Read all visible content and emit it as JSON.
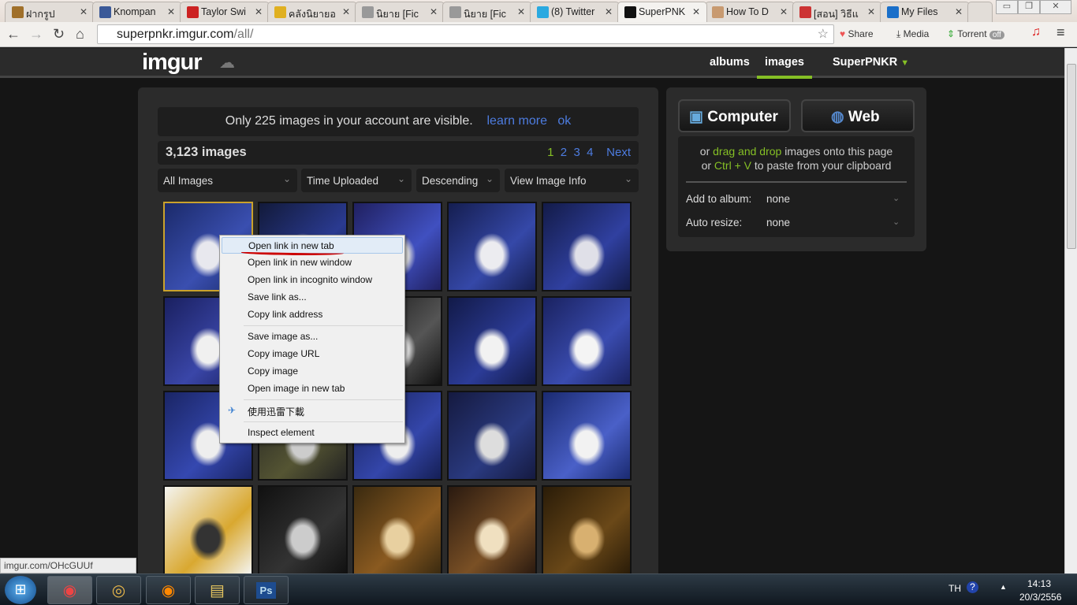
{
  "browser": {
    "tabs": [
      {
        "title": "ฝากรูป",
        "favicon": "iz-icon",
        "color": "#a0702a"
      },
      {
        "title": "Knompan",
        "favicon": "facebook-icon",
        "color": "#3b5998"
      },
      {
        "title": "Taylor Swi",
        "favicon": "youtube-icon",
        "color": "#cc2222"
      },
      {
        "title": "คลังนิยายอ",
        "favicon": "dek-d-icon",
        "color": "#e0b020"
      },
      {
        "title": "นิยาย [Fic",
        "favicon": "ring-icon",
        "color": "#999999"
      },
      {
        "title": "นิยาย [Fic",
        "favicon": "ring-icon",
        "color": "#999999"
      },
      {
        "title": "(8) Twitter",
        "favicon": "twitter-icon",
        "color": "#2aa9e0"
      },
      {
        "title": "SuperPNK",
        "favicon": "imgur-icon",
        "color": "#111111",
        "active": true
      },
      {
        "title": "How To D",
        "favicon": "photo-icon",
        "color": "#c89a70"
      },
      {
        "title": "[สอน] วิธีแ",
        "favicon": "photo-icon",
        "color": "#cc3333"
      },
      {
        "title": "My Files",
        "favicon": "cloud-icon",
        "color": "#1a6fc9"
      }
    ],
    "url_host": "superpnkr.imgur.com",
    "url_path": "/all/",
    "extensions": {
      "share": "Share",
      "media": "Media",
      "torrent": "Torrent",
      "torrent_toggle": "off"
    }
  },
  "imgur": {
    "logo": "imgur",
    "nav": {
      "albums": "albums",
      "images": "images",
      "user": "SuperPNKR"
    },
    "notice": {
      "text": "Only 225 images in your account are visible.",
      "learn_more": "learn more",
      "ok": "ok"
    },
    "count": "3,123 images",
    "pages": [
      "1",
      "2",
      "3",
      "4"
    ],
    "current_page": "1",
    "next": "Next",
    "filters": [
      "All Images",
      "Time Uploaded",
      "Descending",
      "View Image Info"
    ],
    "upload": {
      "computer": "Computer",
      "web": "Web",
      "line1_pre": "or ",
      "line1_hl": "drag and drop",
      "line1_post": " images onto this page",
      "line2_pre": "or ",
      "line2_hl": "Ctrl + V",
      "line2_post": " to paste from your clipboard",
      "album_label": "Add to album:",
      "album_value": "none",
      "resize_label": "Auto resize:",
      "resize_value": "none"
    }
  },
  "context_menu": {
    "group1": [
      "Open link in new tab",
      "Open link in new window",
      "Open link in incognito window",
      "Save link as...",
      "Copy link address"
    ],
    "group2": [
      "Save image as...",
      "Copy image URL",
      "Copy image",
      "Open image in new tab"
    ],
    "group3": [
      "使用迅雷下載"
    ],
    "group4": [
      "Inspect element"
    ]
  },
  "status_url": "imgur.com/OHcGUUf",
  "taskbar": {
    "lang": "TH",
    "time": "14:13",
    "date": "20/3/2556",
    "photoshop": "Ps"
  },
  "colors": {
    "accent": "#85bf25",
    "link": "#4d7ce0",
    "selected_border": "#caa22c"
  }
}
